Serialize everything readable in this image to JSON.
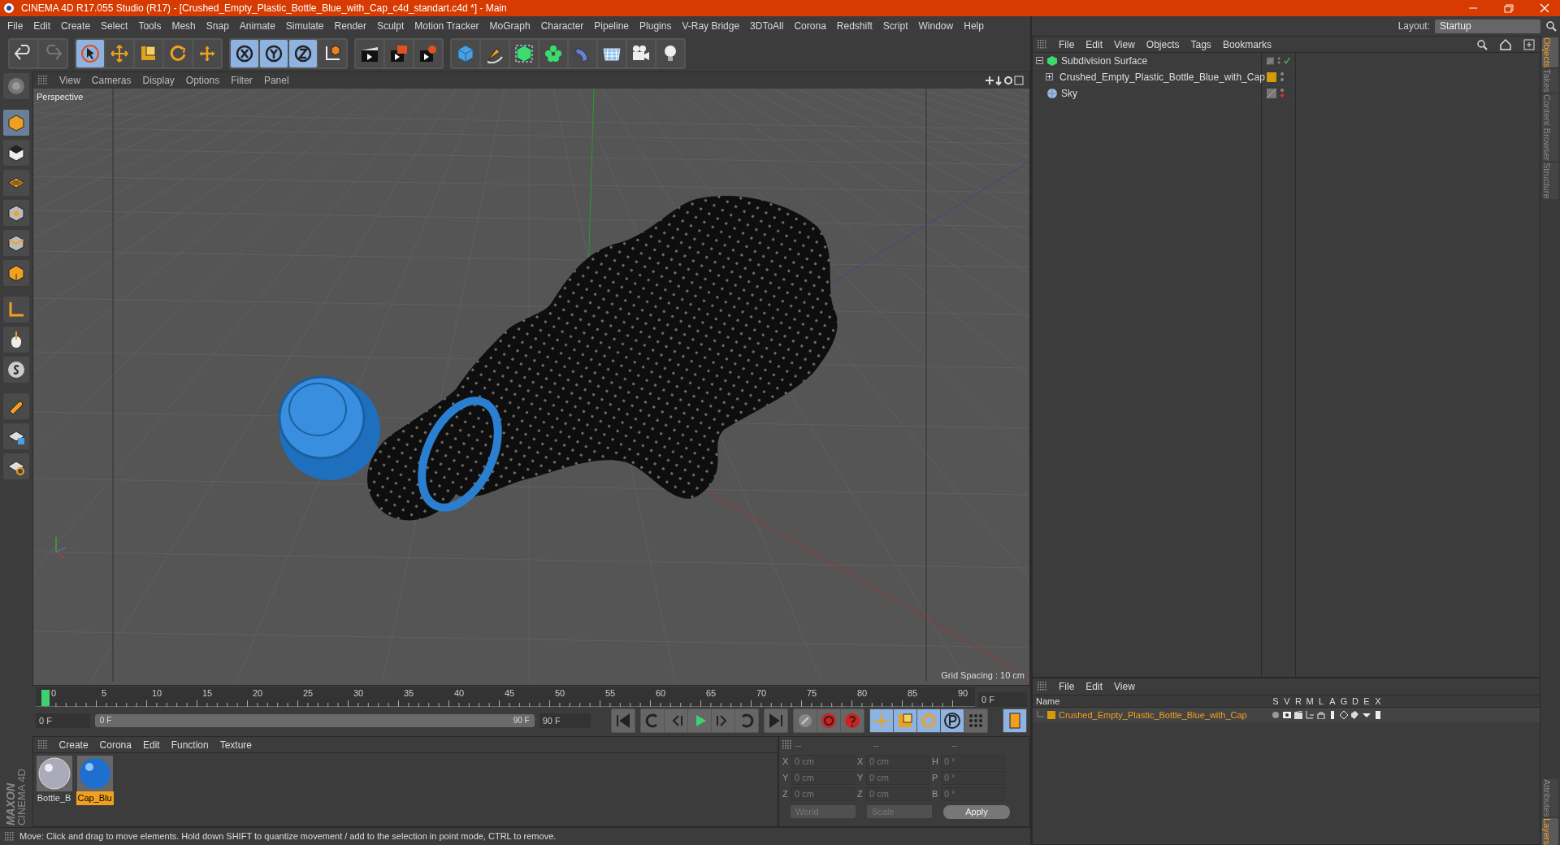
{
  "window": {
    "title": "CINEMA 4D R17.055 Studio (R17) - [Crushed_Empty_Plastic_Bottle_Blue_with_Cap_c4d_standart.c4d *] - Main"
  },
  "menu": [
    "File",
    "Edit",
    "Create",
    "Select",
    "Tools",
    "Mesh",
    "Snap",
    "Animate",
    "Simulate",
    "Render",
    "Sculpt",
    "Motion Tracker",
    "MoGraph",
    "Character",
    "Pipeline",
    "Plugins",
    "V-Ray Bridge",
    "3DToAll",
    "Corona",
    "Redshift",
    "Script",
    "Window",
    "Help"
  ],
  "layout": {
    "label": "Layout:",
    "value": "Startup"
  },
  "toolbar": [
    {
      "on": false
    },
    {
      "on": false
    },
    {
      "on": true
    },
    {
      "on": false
    },
    {
      "on": false
    },
    {
      "on": false
    },
    {
      "on": false
    },
    {
      "on": true
    },
    {
      "on": true
    },
    {
      "on": true
    },
    {
      "on": false
    },
    {
      "on": false
    },
    {
      "on": false
    },
    {
      "on": false
    },
    {
      "on": false
    },
    {
      "on": false
    },
    {
      "on": false
    },
    {
      "on": false
    },
    {
      "on": false
    },
    {
      "on": false
    },
    {
      "on": false
    },
    {
      "on": false
    }
  ],
  "left_tools": [
    {
      "on": false
    },
    {
      "on": true
    },
    {
      "on": false
    },
    {
      "on": false
    },
    {
      "on": false
    },
    {
      "on": false
    },
    {
      "on": false
    },
    {
      "on": false
    },
    {
      "on": false
    },
    {
      "on": false
    },
    {
      "on": false
    },
    {
      "on": false
    },
    {
      "on": false
    }
  ],
  "viewport": {
    "menu": [
      "View",
      "Cameras",
      "Display",
      "Options",
      "Filter",
      "Panel"
    ],
    "camera": "Perspective",
    "grid_spacing": "Grid Spacing : 10 cm"
  },
  "timeline": {
    "ticks": [
      "0",
      "5",
      "10",
      "15",
      "20",
      "25",
      "30",
      "35",
      "40",
      "45",
      "50",
      "55",
      "60",
      "65",
      "70",
      "75",
      "80",
      "85",
      "90"
    ],
    "current": "0 F",
    "start": "0 F",
    "range": {
      "start": "0 F",
      "end": "90 F",
      "level": 1
    },
    "end": "90 F",
    "controls": [
      {
        "on": false
      },
      {
        "on": false
      },
      {
        "on": false
      },
      {
        "on": false
      },
      {
        "on": false
      },
      {
        "on": false
      },
      {
        "on": false
      },
      {
        "on": false
      },
      {
        "on": false
      },
      {
        "on": false
      },
      {
        "on": true
      },
      {
        "on": true
      },
      {
        "on": true
      },
      {
        "on": true
      },
      {
        "on": false
      },
      {
        "on": true
      }
    ]
  },
  "materials": {
    "menu": [
      "Create",
      "Corona",
      "Edit",
      "Function",
      "Texture"
    ],
    "items": [
      {
        "name": "Bottle_B",
        "selected": false
      },
      {
        "name": "Cap_Blu",
        "selected": true
      }
    ]
  },
  "logo": {
    "line_1": "MAXON",
    "line_2": "CINEMA 4D"
  },
  "coordinates": {
    "headers": [
      "--",
      "--",
      "--"
    ],
    "rows": [
      {
        "axis": "X",
        "position": "0 cm",
        "size_axis": "X",
        "size": "0 cm",
        "rot_axis": "H",
        "rotation": "0 °"
      },
      {
        "axis": "Y",
        "position": "0 cm",
        "size_axis": "Y",
        "size": "0 cm",
        "rot_axis": "P",
        "rotation": "0 °"
      },
      {
        "axis": "Z",
        "position": "0 cm",
        "size_axis": "Z",
        "size": "0 cm",
        "rot_axis": "B",
        "rotation": "0 °"
      }
    ],
    "mode": "World",
    "size_mode": "Scale",
    "apply": "Apply"
  },
  "objects": {
    "menu": [
      "File",
      "Edit",
      "View",
      "Objects",
      "Tags",
      "Bookmarks"
    ],
    "tree": [
      {
        "name": "Subdivision Surface",
        "kind": "subdivision",
        "expanded": true,
        "enabled": true,
        "children": [
          {
            "name": "Crushed_Empty_Plastic_Bottle_Blue_with_Cap",
            "kind": "null",
            "expanded": false,
            "color": "#d49a0c"
          }
        ]
      },
      {
        "name": "Sky",
        "kind": "sky",
        "render_off": true
      }
    ]
  },
  "layers": {
    "menu": [
      "File",
      "Edit",
      "View"
    ],
    "columns": [
      "Name",
      "S",
      "V",
      "R",
      "M",
      "L",
      "A",
      "G",
      "D",
      "E",
      "X"
    ],
    "rows": [
      {
        "name": "Crushed_Empty_Plastic_Bottle_Blue_with_Cap",
        "color": "#d49a0c"
      }
    ]
  },
  "side_tabs_top": [
    {
      "label": "Objects",
      "selected": true
    },
    {
      "label": "Takes",
      "selected": false
    },
    {
      "label": "Content Browser",
      "selected": false
    },
    {
      "label": "Structure",
      "selected": false
    }
  ],
  "side_tabs_bottom": [
    {
      "label": "Attributes",
      "selected": false
    },
    {
      "label": "Layers",
      "selected": true
    }
  ],
  "status_bar": "Move: Click and drag to move elements. Hold down SHIFT to quantize movement / add to the selection in point mode, CTRL to remove."
}
